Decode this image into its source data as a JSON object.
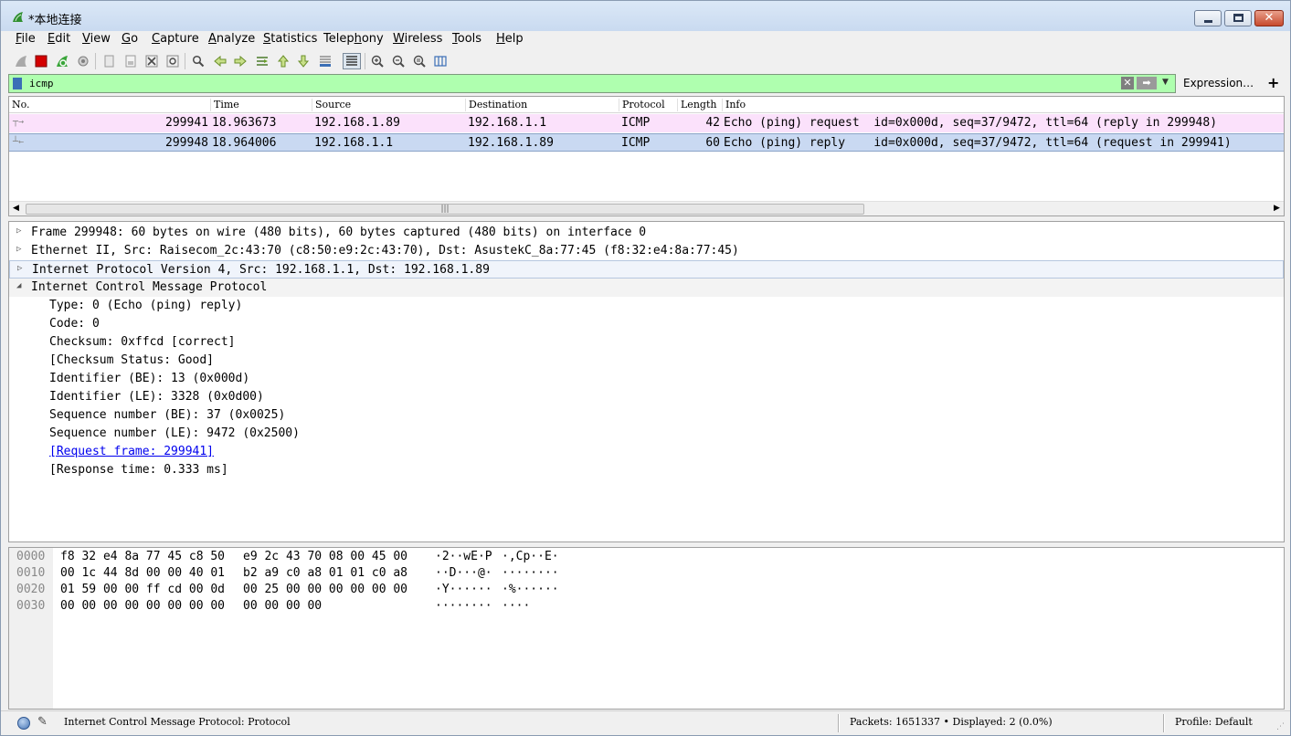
{
  "window": {
    "title": "*本地连接"
  },
  "menu": [
    {
      "accel": "F",
      "rest": "ile"
    },
    {
      "accel": "E",
      "rest": "dit"
    },
    {
      "accel": "V",
      "rest": "iew"
    },
    {
      "accel": "G",
      "rest": "o"
    },
    {
      "accel": "C",
      "rest": "apture"
    },
    {
      "accel": "A",
      "rest": "nalyze"
    },
    {
      "accel": "S",
      "rest": "tatistics"
    },
    {
      "accel": "",
      "pre": "Telep",
      "u": "h",
      "post": "ony"
    },
    {
      "accel": "W",
      "rest": "ireless"
    },
    {
      "accel": "T",
      "rest": "ools"
    },
    {
      "accel": "H",
      "rest": "elp"
    }
  ],
  "filter": {
    "value": "icmp",
    "expression_label": "Expression…",
    "add_label": "+"
  },
  "packet_list": {
    "columns": [
      "No.",
      "Time",
      "Source",
      "Destination",
      "Protocol",
      "Length",
      "Info"
    ],
    "rows": [
      {
        "no": "299941",
        "time": "18.963673",
        "source": "192.168.1.89",
        "destination": "192.168.1.1",
        "protocol": "ICMP",
        "length": "42",
        "info": "Echo (ping) request  id=0x000d, seq=37/9472, ttl=64 (reply in 299948)"
      },
      {
        "no": "299948",
        "time": "18.964006",
        "source": "192.168.1.1",
        "destination": "192.168.1.89",
        "protocol": "ICMP",
        "length": "60",
        "info": "Echo (ping) reply    id=0x000d, seq=37/9472, ttl=64 (request in 299941)"
      }
    ]
  },
  "details": {
    "top": [
      "Frame 299948: 60 bytes on wire (480 bits), 60 bytes captured (480 bits) on interface 0",
      "Ethernet II, Src: Raisecom_2c:43:70 (c8:50:e9:2c:43:70), Dst: AsustekC_8a:77:45 (f8:32:e4:8a:77:45)",
      "Internet Protocol Version 4, Src: 192.168.1.1, Dst: 192.168.1.89",
      "Internet Control Message Protocol"
    ],
    "icmp_fields": [
      "Type: 0 (Echo (ping) reply)",
      "Code: 0",
      "Checksum: 0xffcd [correct]",
      "[Checksum Status: Good]",
      "Identifier (BE): 13 (0x000d)",
      "Identifier (LE): 3328 (0x0d00)",
      "Sequence number (BE): 37 (0x0025)",
      "Sequence number (LE): 9472 (0x2500)",
      "[Request frame: 299941]",
      "[Response time: 0.333 ms]"
    ]
  },
  "hex": [
    {
      "offset": "0000",
      "b1": "f8 32 e4 8a 77 45 c8 50",
      "b2": "e9 2c 43 70 08 00 45 00",
      "a1": "·2··wE·P",
      "a2": "·,Cp··E·"
    },
    {
      "offset": "0010",
      "b1": "00 1c 44 8d 00 00 40 01",
      "b2": "b2 a9 c0 a8 01 01 c0 a8",
      "a1": "··D···@·",
      "a2": "········"
    },
    {
      "offset": "0020",
      "b1": "01 59 00 00 ff cd 00 0d",
      "b2": "00 25 00 00 00 00 00 00",
      "a1": "·Y······",
      "a2": "·%······"
    },
    {
      "offset": "0030",
      "b1": "00 00 00 00 00 00 00 00",
      "b2": "00 00 00 00",
      "a1": "········",
      "a2": "····"
    }
  ],
  "status": {
    "message": "Internet Control Message Protocol: Protocol",
    "packets": "Packets: 1651337 • Displayed: 2 (0.0%)",
    "profile": "Profile: Default"
  }
}
